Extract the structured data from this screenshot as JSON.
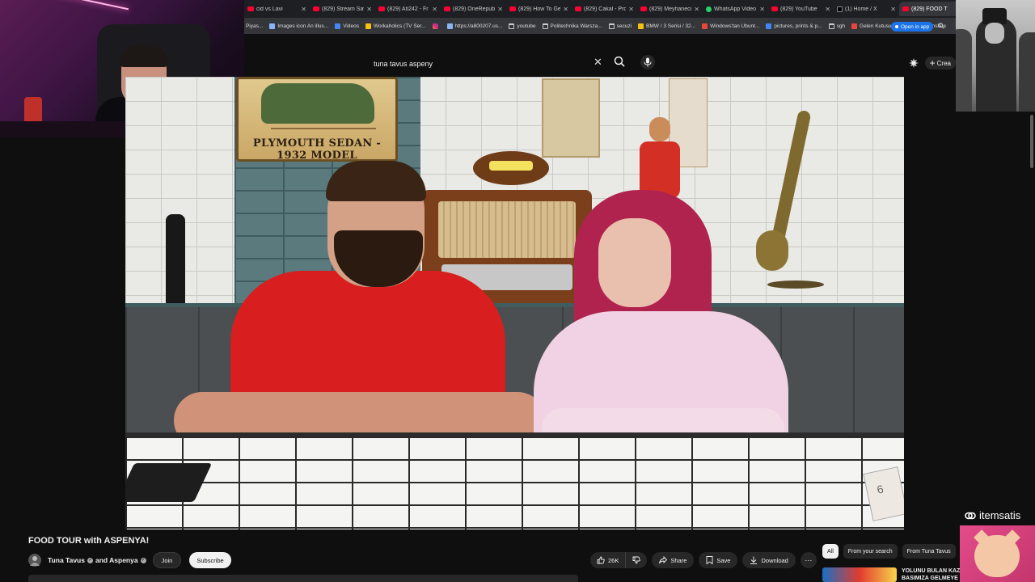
{
  "browser": {
    "tabs": [
      {
        "title": "cid vs Lavi",
        "favicon": "red"
      },
      {
        "title": "(829) Stream Sav",
        "favicon": "youtube"
      },
      {
        "title": "(829) Ati242 - Fr",
        "favicon": "youtube"
      },
      {
        "title": "(829) OneRepubli",
        "favicon": "youtube"
      },
      {
        "title": "(829) How To Ge",
        "favicon": "youtube"
      },
      {
        "title": "(829) Cakal - Pro",
        "favicon": "youtube"
      },
      {
        "title": "(829) Meyhaneci",
        "favicon": "youtube"
      },
      {
        "title": "WhatsApp Video",
        "favicon": "whatsapp"
      },
      {
        "title": "(829) YouTube",
        "favicon": "youtube"
      },
      {
        "title": "(1) Home / X",
        "favicon": "x"
      },
      {
        "title": "(829) FOOD T",
        "favicon": "youtube",
        "active": true
      }
    ],
    "bookmarks": [
      {
        "label": "Piyas...",
        "icon": "none"
      },
      {
        "label": "Images icon An illus...",
        "icon": "doc"
      },
      {
        "label": "Videos",
        "icon": "google"
      },
      {
        "label": "Workaholics (TV Ser...",
        "icon": "yellow"
      },
      {
        "label": "",
        "icon": "instagram"
      },
      {
        "label": "https://a800207.us...",
        "icon": "doc"
      },
      {
        "label": "youtube",
        "icon": "folder"
      },
      {
        "label": "Politechnika Warsza...",
        "icon": "folder"
      },
      {
        "label": "secuzi",
        "icon": "folder"
      },
      {
        "label": "BMW / 3 Serisi / 32...",
        "icon": "yellow"
      },
      {
        "label": "Windows'tan Ubunt...",
        "icon": "red"
      },
      {
        "label": "pictures, prints & p...",
        "icon": "blue"
      },
      {
        "label": "sgh",
        "icon": "folder"
      },
      {
        "label": "Gelen Kutusu",
        "icon": "red"
      },
      {
        "label": "Google Translate",
        "icon": "blue"
      }
    ],
    "open_in_app": "Open in app"
  },
  "youtube": {
    "search_value": "tuna tavus aspeny",
    "create_label": "Crea",
    "video": {
      "sign_text": "PLYMOUTH SEDAN - 1932 MODEL",
      "table_number": "6"
    },
    "watermark": "itemsatis",
    "title": "FOOD TOUR with ASPENYA!",
    "channel": "Tuna Tavus",
    "channel_and": "and Aspenya",
    "join_label": "Join",
    "subscribe_label": "Subscribe",
    "likes": "26K",
    "share_label": "Share",
    "save_label": "Save",
    "download_label": "Download",
    "chips": [
      {
        "label": "All",
        "active": true
      },
      {
        "label": "From your search",
        "active": false
      },
      {
        "label": "From Tuna Tavus",
        "active": false
      }
    ],
    "recommendation": {
      "title_line1": "YOLUNU BULAN KAZ",
      "title_line2": "BASIMIZA GELMEYE"
    }
  },
  "colors": {
    "accent": "#ff0033",
    "background": "#0f0f0f",
    "chip_bg": "#272727",
    "open_in_app_bg": "#1a73e8"
  }
}
